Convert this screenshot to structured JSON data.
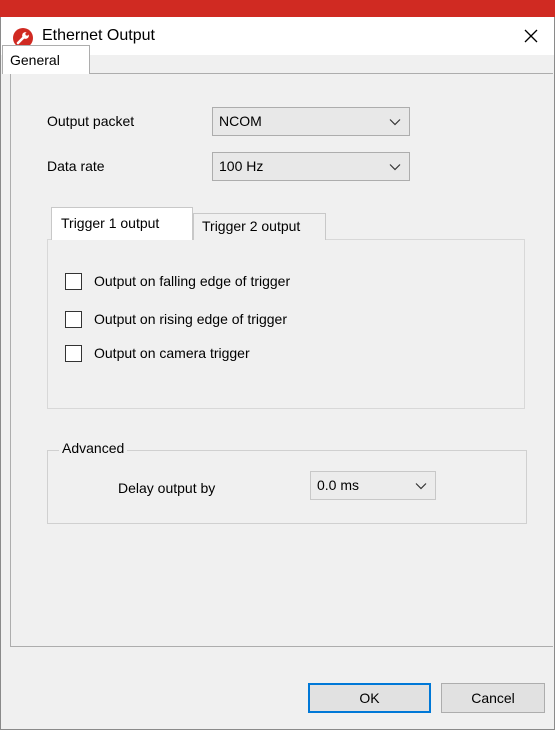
{
  "window": {
    "title": "Ethernet Output",
    "accent_color": "#d02a22",
    "icon": "wrench-app-icon",
    "close_icon": "close-icon"
  },
  "tabs": [
    {
      "label": "General",
      "selected": true
    }
  ],
  "general": {
    "output_packet": {
      "label": "Output packet",
      "value": "NCOM"
    },
    "data_rate": {
      "label": "Data rate",
      "value": "100 Hz"
    },
    "trigger_tabs": [
      {
        "label": "Trigger 1 output",
        "selected": true
      },
      {
        "label": "Trigger 2 output",
        "selected": false
      }
    ],
    "trigger_options": [
      {
        "label": "Output on falling edge of trigger",
        "checked": false
      },
      {
        "label": "Output on rising edge of trigger",
        "checked": false
      },
      {
        "label": "Output on camera trigger",
        "checked": false
      }
    ],
    "advanced": {
      "legend": "Advanced",
      "delay_label": "Delay output by",
      "delay_value": "0.0 ms"
    }
  },
  "buttons": {
    "ok": "OK",
    "cancel": "Cancel"
  }
}
